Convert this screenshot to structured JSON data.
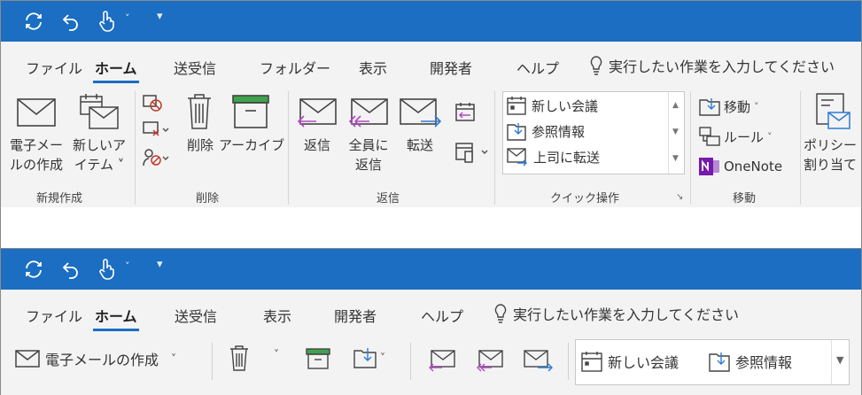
{
  "colors": {
    "titlebar": "#1b6ec2",
    "accent": "#1b6ec2",
    "purple_arrow": "#b548c6",
    "blue_arrow": "#2d7ad6",
    "archive_green": "#3fa34d",
    "onenote": "#7719aa"
  },
  "classic": {
    "qat": {
      "icons": [
        "sync-icon",
        "undo-icon",
        "touch-mode-icon",
        "customize-qat-icon"
      ]
    },
    "tabs": [
      "ファイル",
      "ホーム",
      "送受信",
      "フォルダー",
      "表示",
      "開発者",
      "ヘルプ"
    ],
    "active_tab": "ホーム",
    "tell_me": "実行したい作業を入力してください",
    "groups": {
      "new": {
        "label": "新規作成",
        "new_email": [
          "電子メー",
          "ルの作成"
        ],
        "new_items": [
          "新しいア",
          "イテム ˅"
        ]
      },
      "delete": {
        "label": "削除",
        "delete": "削除",
        "archive": "アーカイブ"
      },
      "respond": {
        "label": "返信",
        "reply": "返信",
        "reply_all": [
          "全員に",
          "返信"
        ],
        "forward": "転送"
      },
      "quick_steps": {
        "label": "クイック操作",
        "items": [
          "新しい会議",
          "参照情報",
          "上司に転送"
        ]
      },
      "move": {
        "label": "移動",
        "move": "移動",
        "rules": "ルール",
        "onenote": "OneNote"
      },
      "policy": [
        "ポリシー",
        "割り当て"
      ]
    }
  },
  "simplified": {
    "tabs": [
      "ファイル",
      "ホーム",
      "送受信",
      "表示",
      "開発者",
      "ヘルプ"
    ],
    "active_tab": "ホーム",
    "tell_me": "実行したい作業を入力してください",
    "new_email": "電子メールの作成",
    "quick_steps": [
      "新しい会議",
      "参照情報"
    ]
  }
}
